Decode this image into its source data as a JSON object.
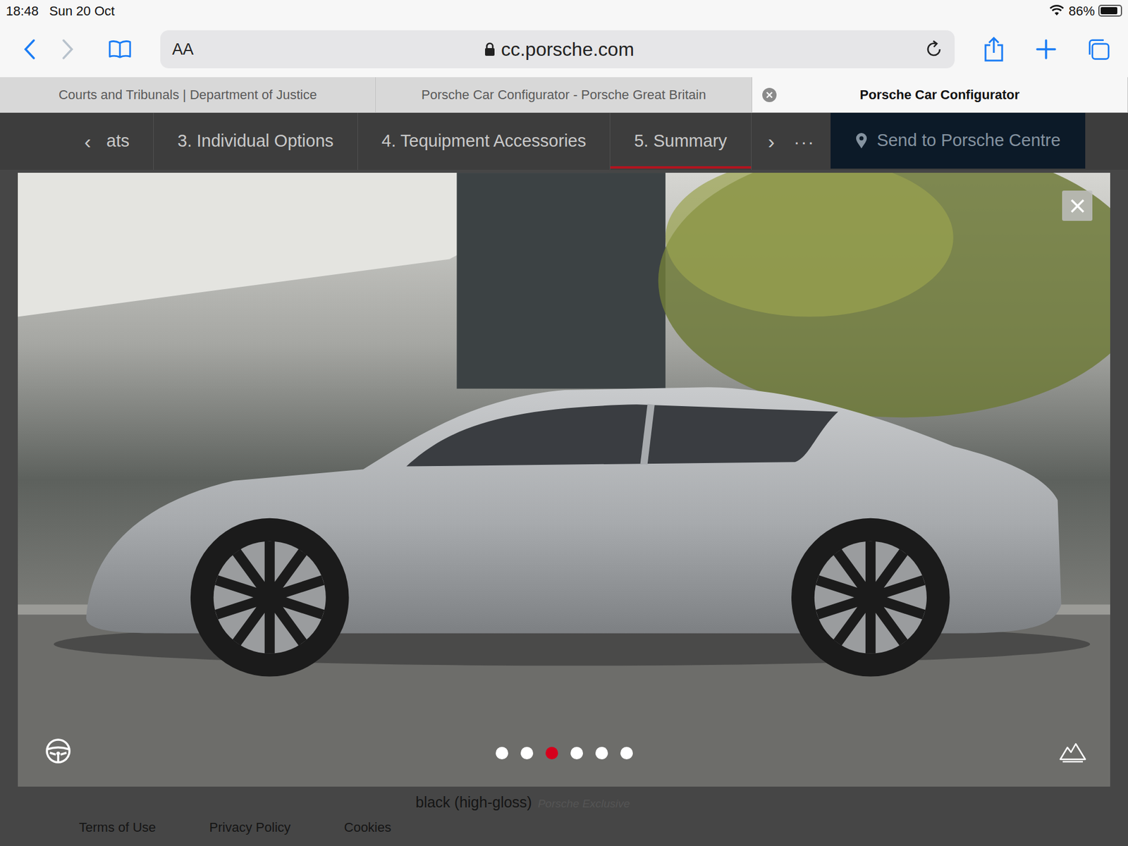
{
  "status_bar": {
    "time": "18:48",
    "date": "Sun 20 Oct",
    "battery": "86%",
    "battery_level": 0.86
  },
  "toolbar": {
    "text_size": "AA",
    "url": "cc.porsche.com"
  },
  "tabs": [
    {
      "label": "Courts and Tribunals | Department of Justice",
      "selected": false,
      "closable": false
    },
    {
      "label": "Porsche Car Configurator - Porsche Great Britain",
      "selected": false,
      "closable": false
    },
    {
      "label": "Porsche Car Configurator",
      "selected": true,
      "closable": true
    }
  ],
  "steps": {
    "prev": "‹",
    "next": "›",
    "more": "···",
    "items": [
      {
        "label": "ats",
        "selected": false
      },
      {
        "label": "3. Individual Options",
        "selected": false
      },
      {
        "label": "4. Tequipment Accessories",
        "selected": false
      },
      {
        "label": "5. Summary",
        "selected": true
      }
    ]
  },
  "send_button": "Send to Porsche Centre",
  "gallery": {
    "slides": [
      {
        "selected": false
      },
      {
        "selected": false
      },
      {
        "selected": true
      },
      {
        "selected": false
      },
      {
        "selected": false
      },
      {
        "selected": false
      }
    ]
  },
  "behind": {
    "text": "black (high-gloss)",
    "tag": "Porsche Exclusive"
  },
  "footer": [
    "Terms of Use",
    "Privacy Policy",
    "Cookies"
  ]
}
